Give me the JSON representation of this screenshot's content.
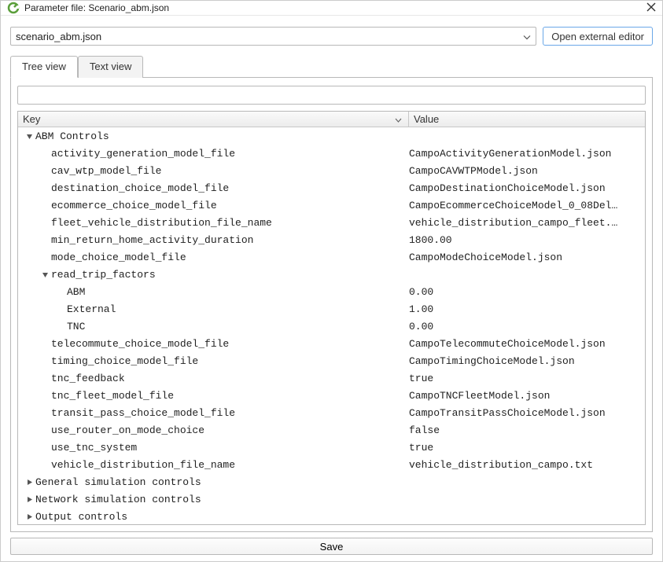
{
  "window": {
    "title": "Parameter file: Scenario_abm.json"
  },
  "toolbar": {
    "file_name": "scenario_abm.json",
    "external_editor_label": "Open external editor"
  },
  "tabs": {
    "tree": "Tree view",
    "text": "Text view",
    "active": "tree"
  },
  "columns": {
    "key": "Key",
    "value": "Value"
  },
  "footer": {
    "save_label": "Save"
  },
  "tree": [
    {
      "indent": 0,
      "expander": "down",
      "key": "ABM Controls",
      "value": ""
    },
    {
      "indent": 1,
      "expander": "",
      "key": "activity_generation_model_file",
      "value": "CampoActivityGenerationModel.json"
    },
    {
      "indent": 1,
      "expander": "",
      "key": "cav_wtp_model_file",
      "value": "CampoCAVWTPModel.json"
    },
    {
      "indent": 1,
      "expander": "",
      "key": "destination_choice_model_file",
      "value": "CampoDestinationChoiceModel.json"
    },
    {
      "indent": 1,
      "expander": "",
      "key": "ecommerce_choice_model_file",
      "value": "CampoEcommerceChoiceModel_0_08Del…"
    },
    {
      "indent": 1,
      "expander": "",
      "key": "fleet_vehicle_distribution_file_name",
      "value": "vehicle_distribution_campo_fleet.…"
    },
    {
      "indent": 1,
      "expander": "",
      "key": "min_return_home_activity_duration",
      "value": "1800.00"
    },
    {
      "indent": 1,
      "expander": "",
      "key": "mode_choice_model_file",
      "value": "CampoModeChoiceModel.json"
    },
    {
      "indent": 1,
      "expander": "down",
      "key": "read_trip_factors",
      "value": ""
    },
    {
      "indent": 2,
      "expander": "",
      "key": "ABM",
      "value": "0.00"
    },
    {
      "indent": 2,
      "expander": "",
      "key": "External",
      "value": "1.00"
    },
    {
      "indent": 2,
      "expander": "",
      "key": "TNC",
      "value": "0.00"
    },
    {
      "indent": 1,
      "expander": "",
      "key": "telecommute_choice_model_file",
      "value": "CampoTelecommuteChoiceModel.json"
    },
    {
      "indent": 1,
      "expander": "",
      "key": "timing_choice_model_file",
      "value": "CampoTimingChoiceModel.json"
    },
    {
      "indent": 1,
      "expander": "",
      "key": "tnc_feedback",
      "value": "true"
    },
    {
      "indent": 1,
      "expander": "",
      "key": "tnc_fleet_model_file",
      "value": "CampoTNCFleetModel.json"
    },
    {
      "indent": 1,
      "expander": "",
      "key": "transit_pass_choice_model_file",
      "value": "CampoTransitPassChoiceModel.json"
    },
    {
      "indent": 1,
      "expander": "",
      "key": "use_router_on_mode_choice",
      "value": "false"
    },
    {
      "indent": 1,
      "expander": "",
      "key": "use_tnc_system",
      "value": "true"
    },
    {
      "indent": 1,
      "expander": "",
      "key": "vehicle_distribution_file_name",
      "value": "vehicle_distribution_campo.txt"
    },
    {
      "indent": 0,
      "expander": "right",
      "key": "General simulation controls",
      "value": ""
    },
    {
      "indent": 0,
      "expander": "right",
      "key": "Network simulation controls",
      "value": ""
    },
    {
      "indent": 0,
      "expander": "right",
      "key": "Output controls",
      "value": ""
    }
  ]
}
